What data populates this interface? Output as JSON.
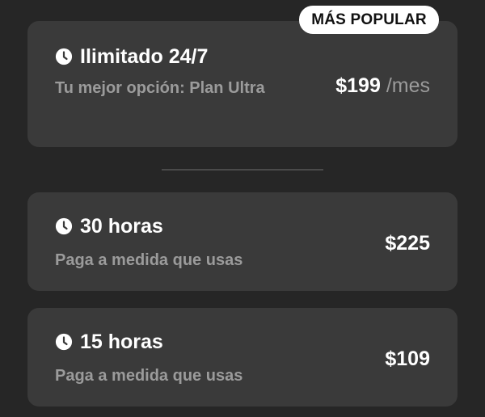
{
  "featured_plan": {
    "badge": "MÁS POPULAR",
    "icon": "clock-icon",
    "title": "Ilimitado 24/7",
    "subtitle": "Tu mejor opción: Plan Ultra",
    "price": "$199",
    "period": " /mes"
  },
  "plans": [
    {
      "icon": "clock-icon",
      "title": "30 horas",
      "subtitle": "Paga a medida que usas",
      "price": "$225"
    },
    {
      "icon": "clock-icon",
      "title": "15 horas",
      "subtitle": "Paga a medida que usas",
      "price": "$109"
    }
  ],
  "colors": {
    "background": "#262626",
    "card": "#3a3a3a",
    "text_primary": "#ffffff",
    "text_secondary": "#9b9b9b",
    "badge_bg": "#ffffff",
    "divider": "#4a4a4a"
  }
}
